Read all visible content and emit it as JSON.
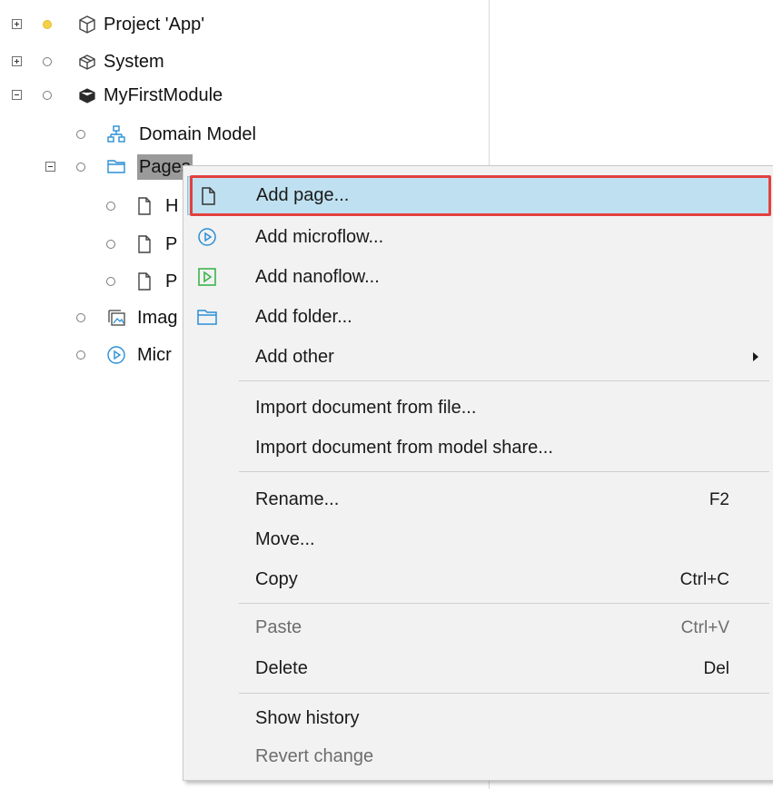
{
  "tree": {
    "items": [
      {
        "label": "Project 'App'",
        "icon": "project-icon",
        "expander": "plus",
        "status": "active"
      },
      {
        "label": "System",
        "icon": "module-icon",
        "expander": "plus",
        "status": "inactive"
      },
      {
        "label": "MyFirstModule",
        "icon": "module-icon",
        "expander": "minus",
        "status": "inactive"
      },
      {
        "label": "Domain Model",
        "icon": "domain-model-icon",
        "status": "inactive"
      },
      {
        "label": "Pages",
        "icon": "folder-icon",
        "expander": "minus",
        "status": "inactive",
        "selected": true
      },
      {
        "label": "H",
        "icon": "page-icon",
        "status": "inactive"
      },
      {
        "label": "P",
        "icon": "page-icon",
        "status": "inactive"
      },
      {
        "label": "P",
        "icon": "page-icon",
        "status": "inactive"
      },
      {
        "label": "Imag",
        "icon": "images-icon",
        "status": "inactive"
      },
      {
        "label": "Micr",
        "icon": "microflow-icon",
        "status": "inactive"
      }
    ]
  },
  "context_menu": {
    "items": [
      {
        "label": "Add page...",
        "icon": "page-icon",
        "highlighted": true
      },
      {
        "label": "Add microflow...",
        "icon": "microflow-icon"
      },
      {
        "label": "Add nanoflow...",
        "icon": "nanoflow-icon"
      },
      {
        "label": "Add folder...",
        "icon": "folder-icon"
      },
      {
        "label": "Add other",
        "has_submenu": true
      },
      {
        "label": "Import document from file..."
      },
      {
        "label": "Import document from model share..."
      },
      {
        "label": "Rename...",
        "shortcut": "F2"
      },
      {
        "label": "Move..."
      },
      {
        "label": "Copy",
        "shortcut": "Ctrl+C"
      },
      {
        "label": "Paste",
        "shortcut": "Ctrl+V",
        "disabled": true
      },
      {
        "label": "Delete",
        "shortcut": "Del"
      },
      {
        "label": "Show history"
      },
      {
        "label": "Revert change",
        "disabled": true
      }
    ]
  },
  "colors": {
    "hover_bg": "#bfe0f0",
    "highlight_border": "#e3403f",
    "status_active": "#f5d14a",
    "microflow_blue": "#2a8fd6",
    "nanoflow_green": "#3bb54a"
  }
}
